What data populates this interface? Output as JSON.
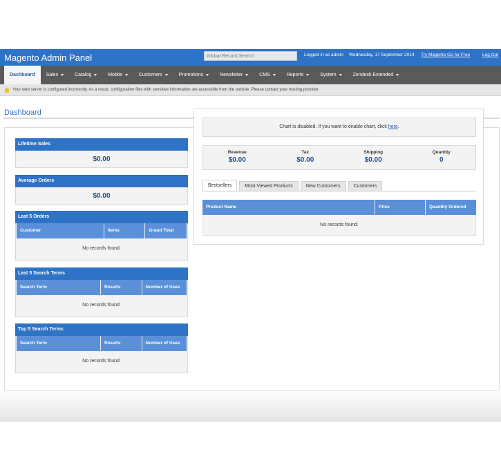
{
  "header": {
    "title": "Magento Admin Panel",
    "search_placeholder": "Global Record Search",
    "logged_in": "Logged in as admin",
    "date": "Wednesday, 17 September 2014",
    "try_link": "Try Magento Go for Free",
    "logout": "Log Out"
  },
  "nav": {
    "items": [
      {
        "label": "Dashboard"
      },
      {
        "label": "Sales"
      },
      {
        "label": "Catalog"
      },
      {
        "label": "Mobile"
      },
      {
        "label": "Customers"
      },
      {
        "label": "Promotions"
      },
      {
        "label": "Newsletter"
      },
      {
        "label": "CMS"
      },
      {
        "label": "Reports"
      },
      {
        "label": "System"
      },
      {
        "label": "Zendesk Extended"
      }
    ]
  },
  "notice": "Your web server is configured incorrectly. As a result, configuration files with sensitive information are accessible from the outside. Please contact your hosting provider.",
  "page_title": "Dashboard",
  "lifetime_sales": {
    "title": "Lifetime Sales",
    "value": "$0.00"
  },
  "average_orders": {
    "title": "Average Orders",
    "value": "$0.00"
  },
  "last_orders": {
    "title": "Last 5 Orders",
    "columns": [
      "Customer",
      "Items",
      "Grand Total"
    ],
    "empty": "No records found."
  },
  "last_search": {
    "title": "Last 5 Search Terms",
    "columns": [
      "Search Term",
      "Results",
      "Number of Uses"
    ],
    "empty": "No records found."
  },
  "top_search": {
    "title": "Top 5 Search Terms",
    "columns": [
      "Search Term",
      "Results",
      "Number of Uses"
    ],
    "empty": "No records found."
  },
  "chart": {
    "message": "Chart is disabled. If you want to enable chart, click",
    "link": "here",
    "end": "."
  },
  "totals": [
    {
      "label": "Revenue",
      "value": "$0.00"
    },
    {
      "label": "Tax",
      "value": "$0.00"
    },
    {
      "label": "Shipping",
      "value": "$0.00"
    },
    {
      "label": "Quantity",
      "value": "0"
    }
  ],
  "tabs": [
    {
      "label": "Bestsellers"
    },
    {
      "label": "Most Viewed Products"
    },
    {
      "label": "New Customers"
    },
    {
      "label": "Customers"
    }
  ],
  "bestsellers": {
    "columns": [
      "Product Name",
      "Price",
      "Quantity Ordered"
    ],
    "empty": "No records found."
  }
}
